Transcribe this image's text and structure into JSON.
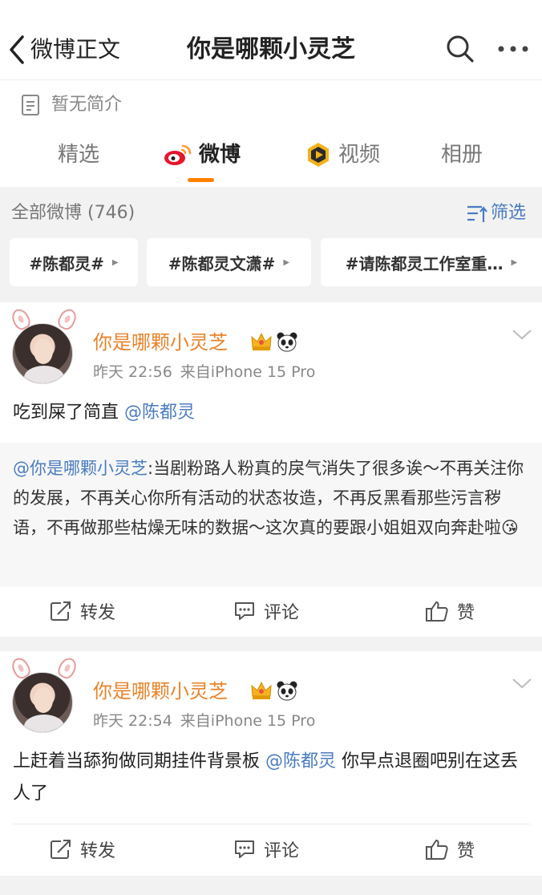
{
  "header": {
    "back_label": "微博正文",
    "title": "你是哪颗小灵芝",
    "search_icon": "search-icon",
    "more_icon": "more-icon"
  },
  "profile": {
    "intro": "暂无简介",
    "intro_icon": "document-icon"
  },
  "tabs": [
    {
      "label": "精选",
      "active": false
    },
    {
      "label": "微博",
      "active": true,
      "icon": "weibo-logo-icon"
    },
    {
      "label": "视频",
      "active": false,
      "icon": "video-play-icon"
    },
    {
      "label": "相册",
      "active": false
    }
  ],
  "filter": {
    "count_label": "全部微博 (746)",
    "filter_label": "筛选",
    "chips": [
      "#陈都灵#",
      "#陈都灵文潇#",
      "#请陈都灵工作室重…"
    ]
  },
  "colors": {
    "accent": "#ff8200",
    "username": "#e8832a",
    "link": "#4a7cc0",
    "background_gray": "#f2f2f2"
  },
  "posts": [
    {
      "username": "你是哪颗小灵芝",
      "time": "昨天 22:56",
      "source": "来自iPhone 15 Pro",
      "text": "吃到屎了简直 ",
      "mention": "@陈都灵",
      "repost": {
        "author": "@你是哪颗小灵芝",
        "text": ":当剧粉路人粉真的戾气消失了很多诶～不再关注你的发展，不再关心你所有活动的状态妆造，不再反黑看那些污言秽语，不再做那些枯燥无味的数据～这次真的要跟小姐姐双向奔赴啦",
        "emoji": "😘"
      },
      "actions": {
        "repost": "转发",
        "comment": "评论",
        "like": "赞"
      }
    },
    {
      "username": "你是哪颗小灵芝",
      "time": "昨天 22:54",
      "source": "来自iPhone 15 Pro",
      "text_before": "上赶着当舔狗做同期挂件背景板 ",
      "mention": "@陈都灵",
      "text_after": " 你早点退圈吧别在这丢人了",
      "actions": {
        "repost": "转发",
        "comment": "评论",
        "like": "赞"
      }
    }
  ]
}
